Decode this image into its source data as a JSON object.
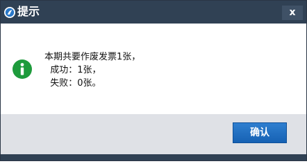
{
  "window": {
    "title": "提示",
    "close_symbol": "x",
    "app_icon": "app-logo-icon"
  },
  "message": {
    "icon": "info-icon",
    "line1": "本期共要作废发票1张，",
    "line2": "  成功：1张，",
    "line3": "  失败：0张。"
  },
  "footer": {
    "ok_label": "确认"
  },
  "colors": {
    "titlebar": "#304154",
    "info_green": "#1e9b3c",
    "button_blue": "#1f6fc3",
    "footer_bg": "#dfe1e6"
  }
}
